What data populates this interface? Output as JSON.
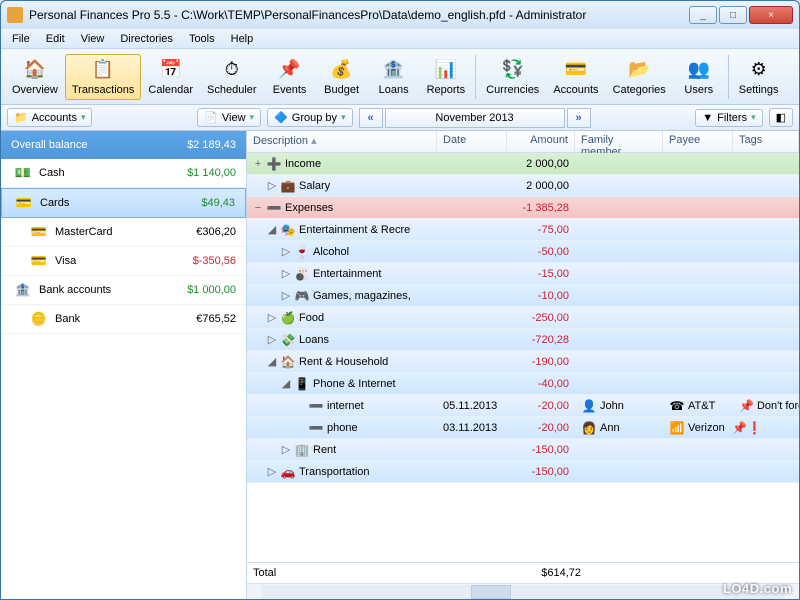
{
  "window": {
    "title": "Personal Finances Pro 5.5 - C:\\Work\\TEMP\\PersonalFinancesPro\\Data\\demo_english.pfd - Administrator",
    "min": "_",
    "max": "□",
    "close": "×"
  },
  "menu": [
    "File",
    "Edit",
    "View",
    "Directories",
    "Tools",
    "Help"
  ],
  "toolbar": [
    {
      "label": "Overview",
      "icon": "🏠"
    },
    {
      "label": "Transactions",
      "icon": "📋",
      "active": true
    },
    {
      "label": "Calendar",
      "icon": "📅"
    },
    {
      "label": "Scheduler",
      "icon": "⏱"
    },
    {
      "label": "Events",
      "icon": "📌"
    },
    {
      "label": "Budget",
      "icon": "💰"
    },
    {
      "label": "Loans",
      "icon": "🏦"
    },
    {
      "label": "Reports",
      "icon": "📊"
    },
    {
      "label": "Currencies",
      "icon": "💱"
    },
    {
      "label": "Accounts",
      "icon": "💳"
    },
    {
      "label": "Categories",
      "icon": "📂"
    },
    {
      "label": "Users",
      "icon": "👥"
    },
    {
      "label": "Settings",
      "icon": "⚙"
    }
  ],
  "subbar": {
    "accounts": "Accounts",
    "view": "View",
    "groupby": "Group by",
    "date": "November 2013",
    "filters": "Filters"
  },
  "sidebar": {
    "balance_label": "Overall balance",
    "balance_value": "$2 189,43",
    "items": [
      {
        "name": "Cash",
        "val": "$1 140,00",
        "icon": "💵",
        "cls": "green"
      },
      {
        "name": "Cards",
        "val": "$49,43",
        "icon": "💳",
        "cls": "green",
        "selected": true
      },
      {
        "name": "MasterCard",
        "val": "€306,20",
        "icon": "💳",
        "sub": true
      },
      {
        "name": "Visa",
        "val": "$-350,56",
        "icon": "💳",
        "cls": "red",
        "sub": true
      },
      {
        "name": "Bank accounts",
        "val": "$1 000,00",
        "icon": "🏦",
        "cls": "green"
      },
      {
        "name": "Bank",
        "val": "€765,52",
        "icon": "🪙",
        "sub": true
      }
    ]
  },
  "grid": {
    "headers": {
      "desc": "Description",
      "date": "Date",
      "amt": "Amount",
      "fam": "Family member",
      "pay": "Payee",
      "tag": "Tags"
    },
    "rows": [
      {
        "t": "income",
        "desc": "Income",
        "amt": "2 000,00",
        "twist": "+",
        "icon": "➕",
        "i": 0
      },
      {
        "t": "blue",
        "desc": "Salary",
        "amt": "2 000,00",
        "twist": "▷",
        "icon": "💼",
        "i": 1
      },
      {
        "t": "expense-h",
        "desc": "Expenses",
        "amt": "-1 385,28",
        "twist": "−",
        "icon": "➖",
        "amtcls": "red",
        "i": 0
      },
      {
        "t": "blue",
        "desc": "Entertainment & Recre",
        "amt": "-75,00",
        "twist": "◢",
        "icon": "🎭",
        "amtcls": "red",
        "i": 1
      },
      {
        "t": "blue2",
        "desc": "Alcohol",
        "amt": "-50,00",
        "twist": "▷",
        "icon": "🍷",
        "amtcls": "red",
        "i": 2
      },
      {
        "t": "blue",
        "desc": "Entertainment",
        "amt": "-15,00",
        "twist": "▷",
        "icon": "🎳",
        "amtcls": "red",
        "i": 2
      },
      {
        "t": "blue2",
        "desc": "Games, magazines,",
        "amt": "-10,00",
        "twist": "▷",
        "icon": "🎮",
        "amtcls": "red",
        "i": 2
      },
      {
        "t": "blue",
        "desc": "Food",
        "amt": "-250,00",
        "twist": "▷",
        "icon": "🍏",
        "amtcls": "red",
        "i": 1
      },
      {
        "t": "blue2",
        "desc": "Loans",
        "amt": "-720,28",
        "twist": "▷",
        "icon": "💸",
        "amtcls": "red",
        "i": 1
      },
      {
        "t": "blue",
        "desc": "Rent & Household",
        "amt": "-190,00",
        "twist": "◢",
        "icon": "🏠",
        "amtcls": "red",
        "i": 1
      },
      {
        "t": "blue2",
        "desc": "Phone & Internet",
        "amt": "-40,00",
        "twist": "◢",
        "icon": "📱",
        "amtcls": "red",
        "i": 2
      },
      {
        "t": "blue",
        "desc": "internet",
        "date": "05.11.2013",
        "amt": "-20,00",
        "twist": "",
        "icon": "➖",
        "amtcls": "red",
        "fam": "John",
        "famicon": "👤",
        "pay": "AT&T",
        "payicon": "☎",
        "tag": "Don't forget!",
        "tagicon": "📌",
        "i": 3
      },
      {
        "t": "blue2",
        "desc": "phone",
        "date": "03.11.2013",
        "amt": "-20,00",
        "twist": "",
        "icon": "➖",
        "amtcls": "red",
        "fam": "Ann",
        "famicon": "👩",
        "pay": "Verizon",
        "payicon": "📶",
        "tag": "",
        "tagicon": "📌❗",
        "i": 3
      },
      {
        "t": "blue",
        "desc": "Rent",
        "amt": "-150,00",
        "twist": "▷",
        "icon": "🏢",
        "amtcls": "red",
        "i": 2
      },
      {
        "t": "blue2",
        "desc": "Transportation",
        "amt": "-150,00",
        "twist": "▷",
        "icon": "🚗",
        "amtcls": "red",
        "i": 1
      }
    ],
    "total_label": "Total",
    "total_value": "$614,72"
  },
  "watermark": "LO4D.com"
}
